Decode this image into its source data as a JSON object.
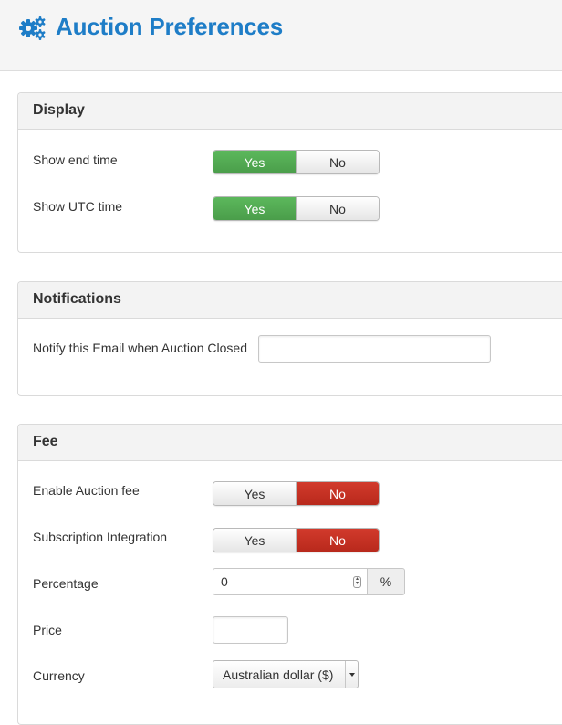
{
  "header": {
    "title": "Auction Preferences",
    "icon": "gears-icon",
    "title_color": "#1e7dc7"
  },
  "display": {
    "heading": "Display",
    "show_end_time": {
      "label": "Show end time",
      "yes": "Yes",
      "no": "No",
      "selected": "Yes"
    },
    "show_utc_time": {
      "label": "Show UTC time",
      "yes": "Yes",
      "no": "No",
      "selected": "Yes"
    }
  },
  "notifications": {
    "heading": "Notifications",
    "notify_email": {
      "label": "Notify this Email when Auction Closed",
      "value": ""
    }
  },
  "fee": {
    "heading": "Fee",
    "enable_auction_fee": {
      "label": "Enable Auction fee",
      "yes": "Yes",
      "no": "No",
      "selected": "No"
    },
    "subscription_integration": {
      "label": "Subscription Integration",
      "yes": "Yes",
      "no": "No",
      "selected": "No"
    },
    "percentage": {
      "label": "Percentage",
      "value": "0",
      "addon": "%"
    },
    "price": {
      "label": "Price",
      "value": ""
    },
    "currency": {
      "label": "Currency",
      "selected": "Australian dollar ($)"
    }
  },
  "colors": {
    "yes_active": "#5cb85c",
    "no_active": "#c0392b"
  }
}
